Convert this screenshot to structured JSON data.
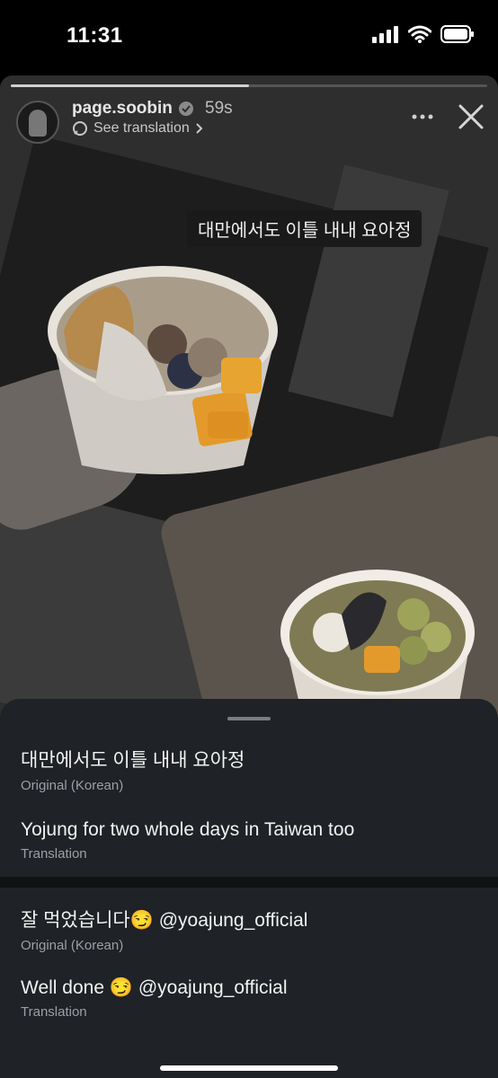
{
  "status_bar": {
    "time": "11:31"
  },
  "story": {
    "progress": 0.5,
    "username": "page.soobin",
    "time_ago": "59s",
    "see_translation": "See translation",
    "caption_korean": "대만에서도 이틀 내내 요아정"
  },
  "translation_sheet": {
    "items": [
      {
        "text": "대만에서도 이틀 내내 요아정",
        "sub": "Original (Korean)"
      },
      {
        "text": "Yojung for two whole days in Taiwan too",
        "sub": "Translation"
      },
      {
        "text": "잘 먹었습니다😏 @yoajung_official",
        "sub": "Original (Korean)"
      },
      {
        "text": "Well done 😏 @yoajung_official",
        "sub": "Translation"
      }
    ]
  },
  "colors": {
    "sheet_bg": "#1f2226",
    "story_bg": "#2e2e2e"
  }
}
